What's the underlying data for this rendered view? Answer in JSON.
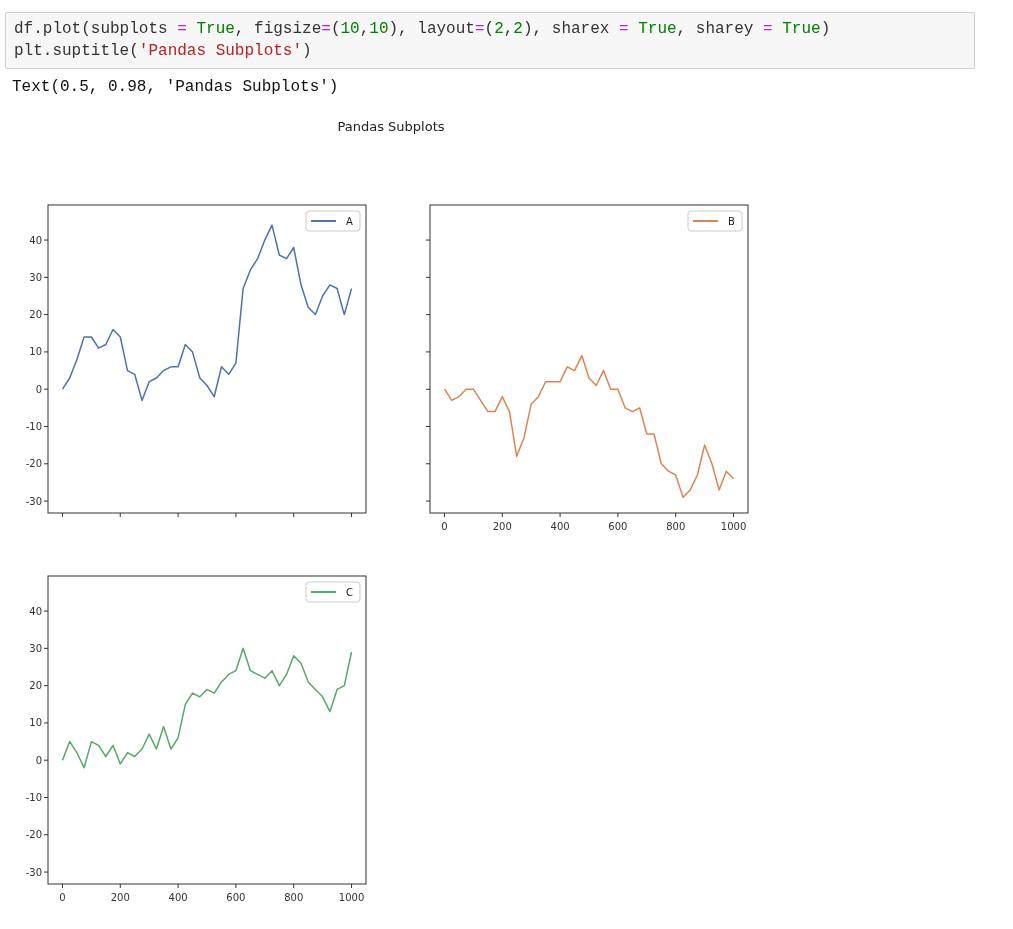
{
  "code_cell": {
    "lines": [
      [
        {
          "kind": "name",
          "text": "df.plot(subplots "
        },
        {
          "kind": "op",
          "text": "= "
        },
        {
          "kind": "kw",
          "text": "True"
        },
        {
          "kind": "name",
          "text": ", figsize"
        },
        {
          "kind": "op",
          "text": "="
        },
        {
          "kind": "name",
          "text": "("
        },
        {
          "kind": "num",
          "text": "10"
        },
        {
          "kind": "name",
          "text": ","
        },
        {
          "kind": "num",
          "text": "10"
        },
        {
          "kind": "name",
          "text": "), layout"
        },
        {
          "kind": "op",
          "text": "="
        },
        {
          "kind": "name",
          "text": "("
        },
        {
          "kind": "num",
          "text": "2"
        },
        {
          "kind": "name",
          "text": ","
        },
        {
          "kind": "num",
          "text": "2"
        },
        {
          "kind": "name",
          "text": "), sharex "
        },
        {
          "kind": "op",
          "text": "= "
        },
        {
          "kind": "kw",
          "text": "True"
        },
        {
          "kind": "name",
          "text": ", sharey "
        },
        {
          "kind": "op",
          "text": "= "
        },
        {
          "kind": "kw",
          "text": "True"
        },
        {
          "kind": "name",
          "text": ")"
        }
      ],
      [
        {
          "kind": "name",
          "text": "plt.suptitle("
        },
        {
          "kind": "str",
          "text": "'Pandas Subplots'"
        },
        {
          "kind": "name",
          "text": ")"
        }
      ]
    ]
  },
  "output_text": "Text(0.5, 0.98, 'Pandas Subplots')",
  "figure": {
    "suptitle": "Pandas Subplots",
    "subplots": [
      {
        "chart_data": {
          "type": "line",
          "x": [
            0,
            25,
            50,
            75,
            100,
            125,
            150,
            175,
            200,
            225,
            250,
            275,
            300,
            325,
            350,
            375,
            400,
            425,
            450,
            475,
            500,
            525,
            550,
            575,
            600,
            625,
            650,
            675,
            700,
            725,
            750,
            775,
            800,
            825,
            850,
            875,
            900,
            925,
            950,
            975,
            1000
          ],
          "series": [
            {
              "name": "A",
              "color": "#4c72b0",
              "values": [
                0,
                3,
                8,
                14,
                14,
                11,
                12,
                16,
                14,
                5,
                4,
                -3,
                2,
                3,
                5,
                6,
                6,
                12,
                10,
                3,
                1,
                -2,
                6,
                4,
                7,
                27,
                32,
                35,
                40,
                44,
                36,
                35,
                38,
                28,
                22,
                20,
                25,
                28,
                27,
                20,
                27
              ]
            }
          ],
          "xlim": [
            -50,
            1050
          ],
          "ylim": [
            -33.2,
            49.4
          ],
          "yticks": [
            -30,
            -20,
            -10,
            0,
            10,
            20,
            30,
            40
          ]
        }
      },
      {
        "chart_data": {
          "type": "line",
          "x": [
            0,
            25,
            50,
            75,
            100,
            125,
            150,
            175,
            200,
            225,
            250,
            275,
            300,
            325,
            350,
            375,
            400,
            425,
            450,
            475,
            500,
            525,
            550,
            575,
            600,
            625,
            650,
            675,
            700,
            725,
            750,
            775,
            800,
            825,
            850,
            875,
            900,
            925,
            950,
            975,
            1000
          ],
          "series": [
            {
              "name": "B",
              "color": "#dd8452",
              "values": [
                0,
                -3,
                -2,
                0,
                0,
                -3,
                -6,
                -6,
                -2,
                -6,
                -18,
                -13,
                -4,
                -2,
                2,
                2,
                2,
                6,
                5,
                9,
                3,
                1,
                5,
                0,
                0,
                -5,
                -6,
                -5,
                -12,
                -12,
                -20,
                -22,
                -23,
                -29,
                -27,
                -23,
                -15,
                -20,
                -27,
                -22,
                -24
              ]
            }
          ],
          "xlim": [
            -50,
            1050
          ],
          "ylim": [
            -33.2,
            49.4
          ],
          "xticks": [
            0,
            200,
            400,
            600,
            800,
            1000
          ]
        }
      },
      {
        "chart_data": {
          "type": "line",
          "x": [
            0,
            25,
            50,
            75,
            100,
            125,
            150,
            175,
            200,
            225,
            250,
            275,
            300,
            325,
            350,
            375,
            400,
            425,
            450,
            475,
            500,
            525,
            550,
            575,
            600,
            625,
            650,
            675,
            700,
            725,
            750,
            775,
            800,
            825,
            850,
            875,
            900,
            925,
            950,
            975,
            1000
          ],
          "series": [
            {
              "name": "C",
              "color": "#55a868",
              "values": [
                0,
                5,
                2,
                -2,
                5,
                4,
                1,
                4,
                -1,
                2,
                1,
                3,
                7,
                3,
                9,
                3,
                6,
                15,
                18,
                17,
                19,
                18,
                21,
                23,
                24,
                30,
                24,
                23,
                22,
                24,
                20,
                23,
                28,
                26,
                21,
                19,
                17,
                13,
                19,
                20,
                29
              ]
            }
          ],
          "xlim": [
            -50,
            1050
          ],
          "ylim": [
            -33.2,
            49.4
          ],
          "xticks": [
            0,
            200,
            400,
            600,
            800,
            1000
          ],
          "yticks": [
            -30,
            -20,
            -10,
            0,
            10,
            20,
            30,
            40
          ]
        }
      }
    ]
  }
}
